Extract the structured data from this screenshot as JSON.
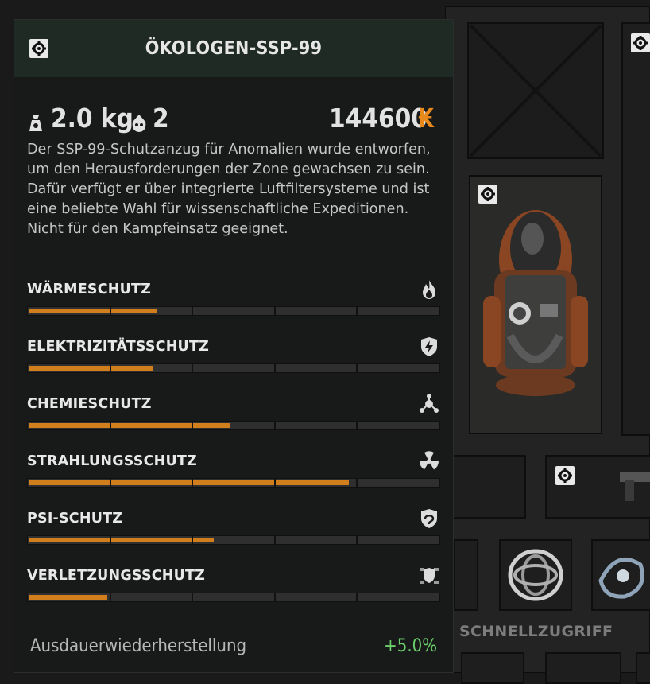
{
  "item": {
    "title": "ÖKOLOGEN-SSP-99",
    "weight": "2.0 kg",
    "slots": "2",
    "price": "144600",
    "currency_symbol": "₭",
    "description": "Der SSP-99-Schutzanzug für Anomalien wurde entworfen, um den Herausforderungen der Zone gewachsen zu sein. Dafür verfügt er über integrierte Luftfiltersysteme und ist eine beliebte Wahl für wissenschaftliche Expeditionen. Nicht für den Kampfeinsatz geeignet."
  },
  "stats": [
    {
      "label": "WÄRMESCHUTZ",
      "icon": "flame-icon",
      "value": 0.31
    },
    {
      "label": "ELEKTRIZITÄTSSCHUTZ",
      "icon": "lightning-shield-icon",
      "value": 0.3
    },
    {
      "label": "CHEMIESCHUTZ",
      "icon": "chemical-icon",
      "value": 0.49
    },
    {
      "label": "STRAHLUNGSSCHUTZ",
      "icon": "radiation-icon",
      "value": 0.78
    },
    {
      "label": "PSI-SCHUTZ",
      "icon": "psi-shield-icon",
      "value": 0.45
    },
    {
      "label": "VERLETZUNGSSCHUTZ",
      "icon": "armor-shield-icon",
      "value": 0.19
    }
  ],
  "footer": {
    "label": "Ausdauerwiederherstellung",
    "value": "+5.0%"
  },
  "inventory": {
    "quick_access_label": "SCHNELLZUGRIFF"
  },
  "colors": {
    "bar_fill": "#d17e1c",
    "positive": "#6bd06b",
    "currency": "#e8891c"
  }
}
